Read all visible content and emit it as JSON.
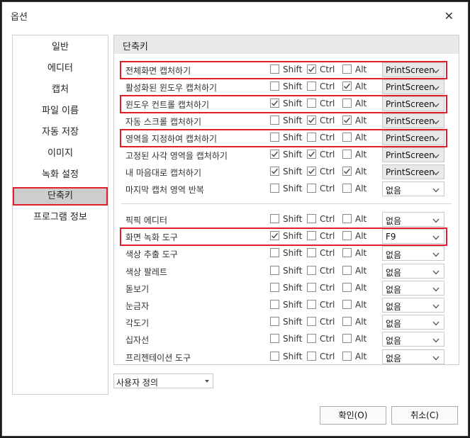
{
  "window": {
    "title": "옵션"
  },
  "nav": [
    {
      "label": "일반"
    },
    {
      "label": "에디터"
    },
    {
      "label": "캡처"
    },
    {
      "label": "파일 이름"
    },
    {
      "label": "자동 저장"
    },
    {
      "label": "이미지"
    },
    {
      "label": "녹화 설정"
    },
    {
      "label": "단축키",
      "active": true
    },
    {
      "label": "프로그램 정보"
    }
  ],
  "panel": {
    "title": "단축키"
  },
  "modifier_labels": {
    "shift": "Shift",
    "ctrl": "Ctrl",
    "alt": "Alt"
  },
  "shortcuts": [
    {
      "label": "전체화면 캡처하기",
      "shift": false,
      "ctrl": true,
      "alt": false,
      "key": "PrintScreen",
      "highlighted": true
    },
    {
      "label": "활성화된 윈도우 캡처하기",
      "shift": false,
      "ctrl": false,
      "alt": true,
      "key": "PrintScreen"
    },
    {
      "label": "윈도우 컨트롤 캡처하기",
      "shift": true,
      "ctrl": false,
      "alt": false,
      "key": "PrintScreen",
      "highlighted": true
    },
    {
      "label": "자동 스크롤 캡처하기",
      "shift": false,
      "ctrl": true,
      "alt": true,
      "key": "PrintScreen"
    },
    {
      "label": "영역을 지정하여 캡처하기",
      "shift": false,
      "ctrl": false,
      "alt": false,
      "key": "PrintScreen",
      "highlighted": true
    },
    {
      "label": "고정된 사각 영역을 캡처하기",
      "shift": true,
      "ctrl": true,
      "alt": false,
      "key": "PrintScreen"
    },
    {
      "label": "내 마음대로 캡처하기",
      "shift": true,
      "ctrl": true,
      "alt": true,
      "key": "PrintScreen"
    },
    {
      "label": "마지막 캡처 영역 반복",
      "shift": false,
      "ctrl": false,
      "alt": false,
      "key": "없음"
    }
  ],
  "tools": [
    {
      "label": "픽픽 에디터",
      "shift": false,
      "ctrl": false,
      "alt": false,
      "key": "없음"
    },
    {
      "label": "화면 녹화 도구",
      "shift": true,
      "ctrl": false,
      "alt": false,
      "key": "F9",
      "highlighted": true
    },
    {
      "label": "색상 추출 도구",
      "shift": false,
      "ctrl": false,
      "alt": false,
      "key": "없음"
    },
    {
      "label": "색상 팔레트",
      "shift": false,
      "ctrl": false,
      "alt": false,
      "key": "없음"
    },
    {
      "label": "돋보기",
      "shift": false,
      "ctrl": false,
      "alt": false,
      "key": "없음"
    },
    {
      "label": "눈금자",
      "shift": false,
      "ctrl": false,
      "alt": false,
      "key": "없음"
    },
    {
      "label": "각도기",
      "shift": false,
      "ctrl": false,
      "alt": false,
      "key": "없음"
    },
    {
      "label": "십자선",
      "shift": false,
      "ctrl": false,
      "alt": false,
      "key": "없음"
    },
    {
      "label": "프리젠테이션 도구",
      "shift": false,
      "ctrl": false,
      "alt": false,
      "key": "없음"
    }
  ],
  "preset": {
    "value": "사용자 정의"
  },
  "buttons": {
    "ok": "확인(O)",
    "cancel": "취소(C)"
  },
  "colors": {
    "highlight": "#e0202a",
    "active_nav": "#cdcdcd",
    "header_bg": "#e9e9e9"
  }
}
